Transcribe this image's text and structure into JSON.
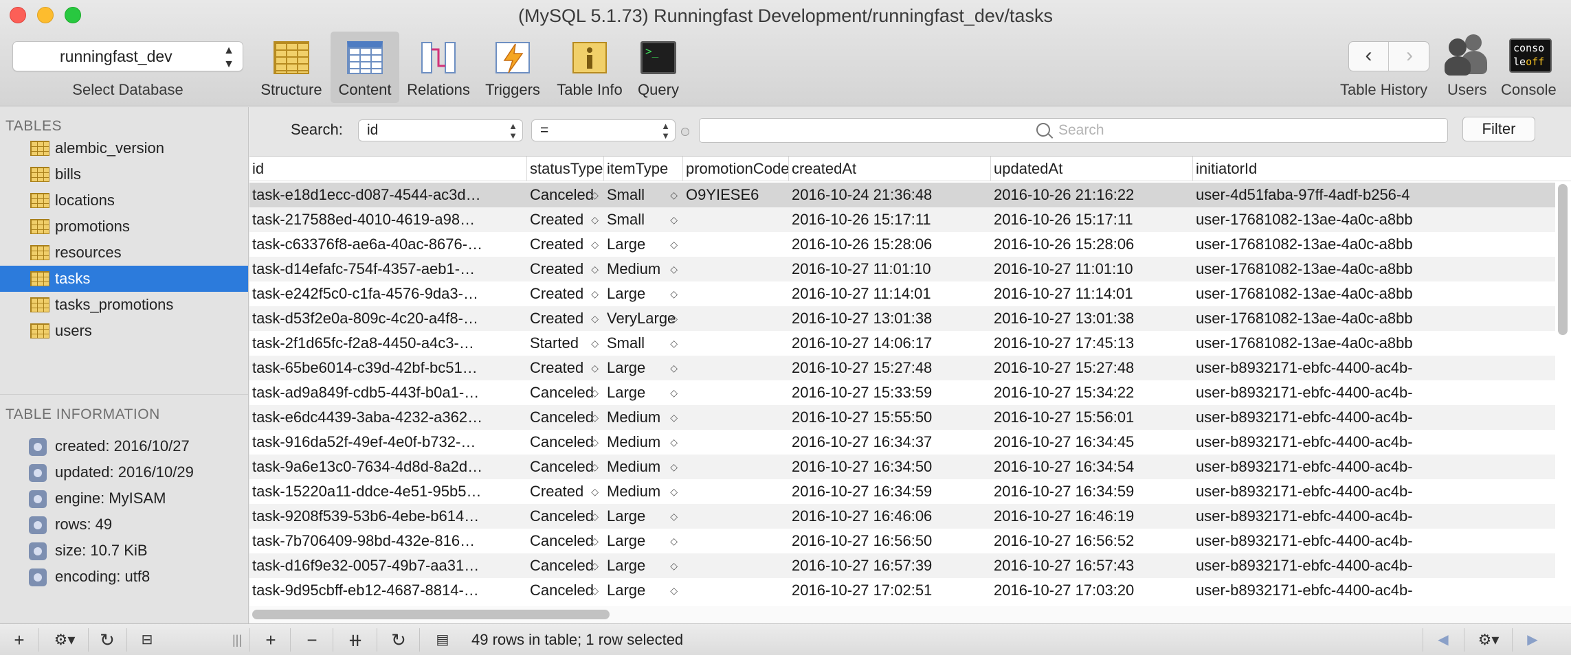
{
  "window": {
    "title": "(MySQL 5.1.73) Runningfast Development/runningfast_dev/tasks"
  },
  "toolbar": {
    "database": "runningfast_dev",
    "database_label": "Select Database",
    "buttons": [
      {
        "label": "Structure",
        "icon": "structure-icon"
      },
      {
        "label": "Content",
        "icon": "content-icon"
      },
      {
        "label": "Relations",
        "icon": "relations-icon"
      },
      {
        "label": "Triggers",
        "icon": "triggers-icon"
      },
      {
        "label": "Table Info",
        "icon": "table-info-icon"
      },
      {
        "label": "Query",
        "icon": "query-icon"
      }
    ],
    "active": "Content",
    "table_history_label": "Table History",
    "users_label": "Users",
    "console_label": "Console",
    "console_icon_text_1": "conso",
    "console_icon_text_2": "le",
    "console_icon_text_3": "off"
  },
  "sidebar": {
    "tables_heading": "TABLES",
    "tables": [
      "alembic_version",
      "bills",
      "locations",
      "promotions",
      "resources",
      "tasks",
      "tasks_promotions",
      "users"
    ],
    "selected": "tasks",
    "info_heading": "TABLE INFORMATION",
    "info": [
      "created: 2016/10/27",
      "updated: 2016/10/29",
      "engine: MyISAM",
      "rows: 49",
      "size: 10.7 KiB",
      "encoding: utf8"
    ]
  },
  "search": {
    "label": "Search:",
    "field": "id",
    "operator": "=",
    "placeholder": "Search",
    "filter_label": "Filter"
  },
  "table": {
    "columns": [
      "id",
      "statusType",
      "itemType",
      "promotionCode",
      "createdAt",
      "updatedAt",
      "initiatorId"
    ],
    "rows": [
      [
        "task-e18d1ecc-d087-4544-ac3d…",
        "Canceled",
        "Small",
        "O9YIESE6",
        "2016-10-24 21:36:48",
        "2016-10-26 21:16:22",
        "user-4d51faba-97ff-4adf-b256-4"
      ],
      [
        "task-217588ed-4010-4619-a98…",
        "Created",
        "Small",
        "",
        "2016-10-26 15:17:11",
        "2016-10-26 15:17:11",
        "user-17681082-13ae-4a0c-a8bb"
      ],
      [
        "task-c63376f8-ae6a-40ac-8676-…",
        "Created",
        "Large",
        "",
        "2016-10-26 15:28:06",
        "2016-10-26 15:28:06",
        "user-17681082-13ae-4a0c-a8bb"
      ],
      [
        "task-d14efafc-754f-4357-aeb1-…",
        "Created",
        "Medium",
        "",
        "2016-10-27 11:01:10",
        "2016-10-27 11:01:10",
        "user-17681082-13ae-4a0c-a8bb"
      ],
      [
        "task-e242f5c0-c1fa-4576-9da3-…",
        "Created",
        "Large",
        "",
        "2016-10-27 11:14:01",
        "2016-10-27 11:14:01",
        "user-17681082-13ae-4a0c-a8bb"
      ],
      [
        "task-d53f2e0a-809c-4c20-a4f8-…",
        "Created",
        "VeryLarge",
        "",
        "2016-10-27 13:01:38",
        "2016-10-27 13:01:38",
        "user-17681082-13ae-4a0c-a8bb"
      ],
      [
        "task-2f1d65fc-f2a8-4450-a4c3-…",
        "Started",
        "Small",
        "",
        "2016-10-27 14:06:17",
        "2016-10-27 17:45:13",
        "user-17681082-13ae-4a0c-a8bb"
      ],
      [
        "task-65be6014-c39d-42bf-bc51…",
        "Created",
        "Large",
        "",
        "2016-10-27 15:27:48",
        "2016-10-27 15:27:48",
        "user-b8932171-ebfc-4400-ac4b-"
      ],
      [
        "task-ad9a849f-cdb5-443f-b0a1-…",
        "Canceled",
        "Large",
        "",
        "2016-10-27 15:33:59",
        "2016-10-27 15:34:22",
        "user-b8932171-ebfc-4400-ac4b-"
      ],
      [
        "task-e6dc4439-3aba-4232-a362…",
        "Canceled",
        "Medium",
        "",
        "2016-10-27 15:55:50",
        "2016-10-27 15:56:01",
        "user-b8932171-ebfc-4400-ac4b-"
      ],
      [
        "task-916da52f-49ef-4e0f-b732-…",
        "Canceled",
        "Medium",
        "",
        "2016-10-27 16:34:37",
        "2016-10-27 16:34:45",
        "user-b8932171-ebfc-4400-ac4b-"
      ],
      [
        "task-9a6e13c0-7634-4d8d-8a2d…",
        "Canceled",
        "Medium",
        "",
        "2016-10-27 16:34:50",
        "2016-10-27 16:34:54",
        "user-b8932171-ebfc-4400-ac4b-"
      ],
      [
        "task-15220a11-ddce-4e51-95b5…",
        "Created",
        "Medium",
        "",
        "2016-10-27 16:34:59",
        "2016-10-27 16:34:59",
        "user-b8932171-ebfc-4400-ac4b-"
      ],
      [
        "task-9208f539-53b6-4ebe-b614…",
        "Canceled",
        "Large",
        "",
        "2016-10-27 16:46:06",
        "2016-10-27 16:46:19",
        "user-b8932171-ebfc-4400-ac4b-"
      ],
      [
        "task-7b706409-98bd-432e-816…",
        "Canceled",
        "Large",
        "",
        "2016-10-27 16:56:50",
        "2016-10-27 16:56:52",
        "user-b8932171-ebfc-4400-ac4b-"
      ],
      [
        "task-d16f9e32-0057-49b7-aa31…",
        "Canceled",
        "Large",
        "",
        "2016-10-27 16:57:39",
        "2016-10-27 16:57:43",
        "user-b8932171-ebfc-4400-ac4b-"
      ],
      [
        "task-9d95cbff-eb12-4687-8814-…",
        "Canceled",
        "Large",
        "",
        "2016-10-27 17:02:51",
        "2016-10-27 17:03:20",
        "user-b8932171-ebfc-4400-ac4b-"
      ]
    ],
    "selected_row": 0
  },
  "statusbar": {
    "text": "49 rows in table; 1 row selected"
  },
  "colors": {
    "selection": "#2c7bdc",
    "close": "#fc5f57",
    "minimize": "#fdbc2e",
    "maximize": "#28c840"
  }
}
